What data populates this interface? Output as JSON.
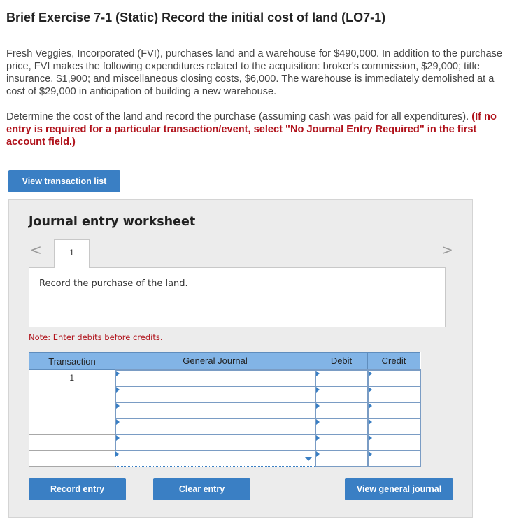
{
  "page": {
    "title": "Brief Exercise 7-1 (Static) Record the initial cost of land (LO7-1)",
    "paragraph1": "Fresh Veggies, Incorporated (FVI), purchases land and a warehouse for $490,000. In addition to the purchase price, FVI makes the following expenditures related to the acquisition: broker's commission, $29,000; title insurance, $1,900; and miscellaneous closing costs, $6,000. The warehouse is immediately demolished at a cost of $29,000 in anticipation of building a new warehouse.",
    "paragraph2": "Determine the cost of the land and record the purchase (assuming cash was paid for all expenditures).",
    "instruction": "(If no entry is required for a particular transaction/event, select \"No Journal Entry Required\" in the first account field.)"
  },
  "buttons": {
    "view_transactions": "View transaction list",
    "record_entry": "Record entry",
    "clear_entry": "Clear entry",
    "view_general_journal": "View general journal"
  },
  "worksheet": {
    "title": "Journal entry worksheet",
    "nav_prev": "<",
    "nav_next": ">",
    "tab_label": "1",
    "description": "Record the purchase of the land.",
    "note": "Note: Enter debits before credits.",
    "columns": [
      "Transaction",
      "General Journal",
      "Debit",
      "Credit"
    ],
    "rows": [
      {
        "transaction": "1",
        "account": "",
        "debit": "",
        "credit": ""
      },
      {
        "transaction": "",
        "account": "",
        "debit": "",
        "credit": ""
      },
      {
        "transaction": "",
        "account": "",
        "debit": "",
        "credit": ""
      },
      {
        "transaction": "",
        "account": "",
        "debit": "",
        "credit": ""
      },
      {
        "transaction": "",
        "account": "",
        "debit": "",
        "credit": ""
      },
      {
        "transaction": "",
        "account": "",
        "debit": "",
        "credit": ""
      }
    ]
  },
  "colors": {
    "accent": "#3a7fc4",
    "header": "#82b4e6",
    "instruction": "#b0121b"
  }
}
